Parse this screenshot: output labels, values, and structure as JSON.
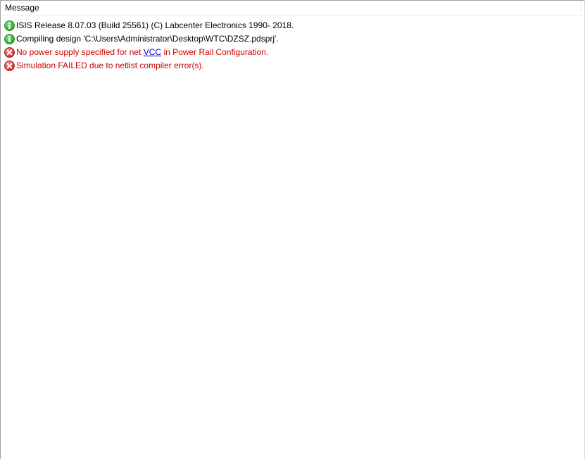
{
  "header": {
    "message_col": "Message"
  },
  "messages": [
    {
      "type": "info",
      "icon": "info-icon",
      "text": "ISIS Release 8.07.03 (Build 25561) (C) Labcenter Electronics 1990- 2018."
    },
    {
      "type": "info",
      "icon": "info-icon",
      "text": "Compiling design 'C:\\Users\\Administrator\\Desktop\\WTC\\DZSZ.pdsprj'."
    },
    {
      "type": "error",
      "icon": "error-icon",
      "text_before": "No power supply specified for net ",
      "link": "VCC",
      "text_after": " in Power Rail Configuration."
    },
    {
      "type": "error",
      "icon": "error-icon",
      "text": "Simulation FAILED due to netlist compiler error(s)."
    }
  ],
  "colors": {
    "info": "#3aa83a",
    "error": "#dd2a2a",
    "error_text": "#cc0000",
    "link": "#0000cc"
  }
}
